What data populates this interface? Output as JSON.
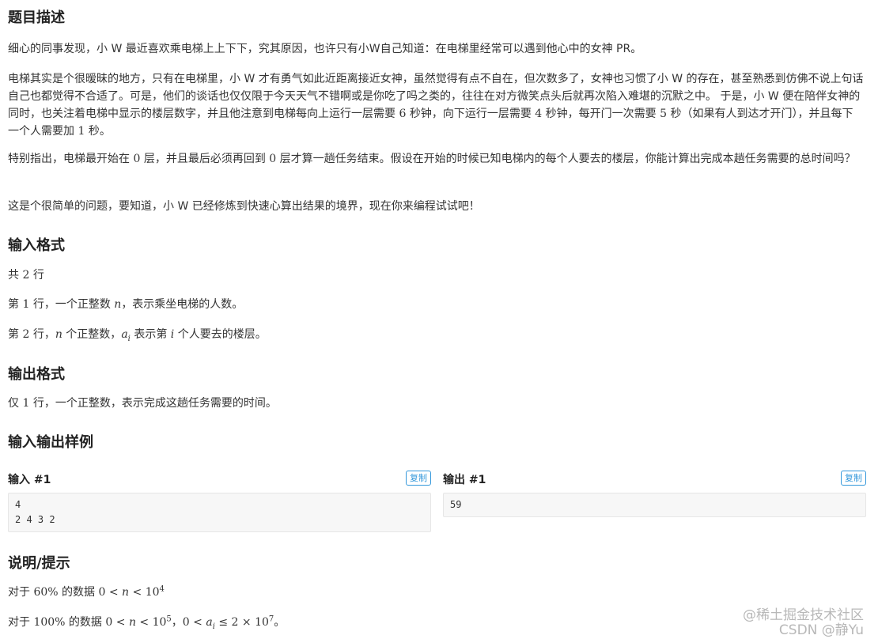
{
  "description": {
    "heading": "题目描述",
    "p1": "细心的同事发现，小 W 最近喜欢乘电梯上上下下，究其原因，也许只有小W自己知道：在电梯里经常可以遇到他心中的女神 PR。",
    "p2_a": "电梯其实是个很暧昧的地方，只有在电梯里，小 W 才有勇气如此近距离接近女神，虽然觉得有点不自在，但次数多了，女神也习惯了小 W 的存在，甚至熟悉到仿佛不说上句话自己也都觉得不合适了。可是，他们的谈话也仅仅限于今天天气不错啊或是你吃了吗之类的，往往在对方微笑点头后就再次陷入难堪的沉默之中。 于是，小 W 便在陪伴女神的同时，也关注着电梯中显示的楼层数字，并且他注意到电梯每向上运行一层需要 ",
    "p2_n1": "6",
    "p2_b": " 秒钟，向下运行一层需要 ",
    "p2_n2": "4",
    "p2_c": " 秒钟，每开门一次需要 ",
    "p2_n3": "5",
    "p2_d": " 秒（如果有人到达才开门），并且每下一个人需要加 ",
    "p2_n4": "1",
    "p2_e": " 秒。",
    "p3_a": "特别指出，电梯最开始在 ",
    "p3_n1": "0",
    "p3_b": " 层，并且最后必须再回到 ",
    "p3_n2": "0",
    "p3_c": " 层才算一趟任务结束。假设在开始的时候已知电梯内的每个人要去的楼层，你能计算出完成本趟任务需要的总时间吗？",
    "p4": "这是个很简单的问题，要知道，小 W 已经修炼到快速心算出结果的境界，现在你来编程试试吧！"
  },
  "input_format": {
    "heading": "输入格式",
    "l1_a": "共 ",
    "l1_n": "2",
    "l1_b": " 行",
    "l2_a": "第 ",
    "l2_n": "1",
    "l2_b": " 行，一个正整数 ",
    "l2_var": "n",
    "l2_c": "，表示乘坐电梯的人数。",
    "l3_a": "第 ",
    "l3_n": "2",
    "l3_b": " 行，",
    "l3_var": "n",
    "l3_c": " 个正整数，",
    "l3_var2": "a",
    "l3_sub": "i",
    "l3_d": " 表示第 ",
    "l3_var3": "i",
    "l3_e": " 个人要去的楼层。"
  },
  "output_format": {
    "heading": "输出格式",
    "l1_a": "仅 ",
    "l1_n": "1",
    "l1_b": " 行，一个正整数，表示完成这趟任务需要的时间。"
  },
  "samples": {
    "heading": "输入输出样例",
    "input_title": "输入 #1",
    "output_title": "输出 #1",
    "copy_label": "复制",
    "input_text": "4\n2 4 3 2",
    "output_text": "59"
  },
  "hint": {
    "heading": "说明/提示",
    "l1_a": "对于 ",
    "l1_pct": "60%",
    "l1_b": " 的数据 ",
    "l1_m1": "0 < ",
    "l1_var": "n",
    "l1_m2": " < 10",
    "l1_exp": "4",
    "l2_a": "对于 ",
    "l2_pct": "100%",
    "l2_b": " 的数据 ",
    "l2_m1": "0 < ",
    "l2_var": "n",
    "l2_m2": " < 10",
    "l2_exp": "5",
    "l2_sep": "，",
    "l2_m3": "0 < ",
    "l2_var2": "a",
    "l2_sub": "i",
    "l2_m4": " ≤ 2 × 10",
    "l2_exp2": "7",
    "l2_end": "。"
  },
  "watermark": {
    "line1": "@稀土掘金技术社区",
    "line2": "CSDN @静Yu"
  }
}
